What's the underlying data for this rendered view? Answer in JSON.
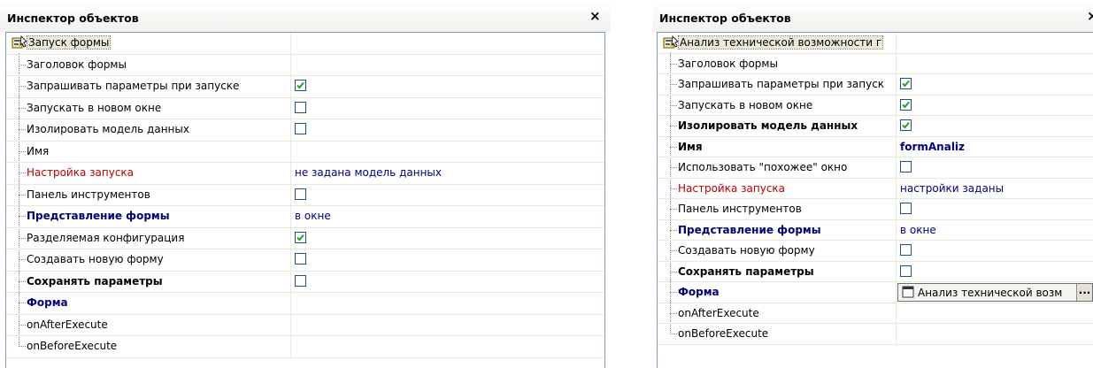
{
  "left": {
    "title": "Инспектор объектов",
    "close": "×",
    "root_label": "Запуск формы",
    "rows": [
      {
        "name": "Заголовок формы",
        "style": "normal",
        "type": "text",
        "value": ""
      },
      {
        "name": "Запрашивать параметры при запуске",
        "style": "normal",
        "type": "checkbox",
        "checked": true
      },
      {
        "name": "Запускать в новом окне",
        "style": "normal",
        "type": "checkbox",
        "checked": false
      },
      {
        "name": "Изолировать модель данных",
        "style": "normal",
        "type": "checkbox",
        "checked": false
      },
      {
        "name": "Имя",
        "style": "normal",
        "type": "text",
        "value": ""
      },
      {
        "name": "Настройка запуска",
        "style": "red",
        "type": "text",
        "value": "не задана модель данных"
      },
      {
        "name": "Панель инструментов",
        "style": "normal",
        "type": "checkbox",
        "checked": false
      },
      {
        "name": "Представление формы",
        "style": "navy",
        "type": "text",
        "value": "в окне"
      },
      {
        "name": "Разделяемая конфигурация",
        "style": "normal",
        "type": "checkbox",
        "checked": true
      },
      {
        "name": "Создавать новую форму",
        "style": "normal",
        "type": "checkbox",
        "checked": false
      },
      {
        "name": "Сохранять параметры",
        "style": "bold",
        "type": "checkbox",
        "checked": false
      },
      {
        "name": "Форма",
        "style": "navy",
        "type": "text",
        "value": ""
      },
      {
        "name": "onAfterExecute",
        "style": "normal",
        "type": "text",
        "value": ""
      },
      {
        "name": "onBeforeExecute",
        "style": "normal",
        "type": "text",
        "value": ""
      }
    ]
  },
  "right": {
    "title": "Инспектор объектов",
    "close": "×",
    "root_label": "Анализ технической возможности г",
    "rows": [
      {
        "name": "Заголовок формы",
        "style": "normal",
        "type": "text",
        "value": ""
      },
      {
        "name": "Запрашивать параметры при запуск",
        "style": "normal",
        "type": "checkbox",
        "checked": true
      },
      {
        "name": "Запускать в новом окне",
        "style": "normal",
        "type": "checkbox",
        "checked": true
      },
      {
        "name": "Изолировать модель данных",
        "style": "bold",
        "type": "checkbox",
        "checked": true
      },
      {
        "name": "Имя",
        "style": "bold",
        "type": "text",
        "value": "formAnaliz",
        "value_bold": true
      },
      {
        "name": "Использовать \"похожее\" окно",
        "style": "normal",
        "type": "checkbox",
        "checked": false
      },
      {
        "name": "Настройка запуска",
        "style": "red",
        "type": "text",
        "value": "настройки заданы"
      },
      {
        "name": "Панель инструментов",
        "style": "normal",
        "type": "checkbox",
        "checked": false
      },
      {
        "name": "Представление формы",
        "style": "navy",
        "type": "text",
        "value": "в окне"
      },
      {
        "name": "Создавать новую форму",
        "style": "normal",
        "type": "checkbox",
        "checked": false
      },
      {
        "name": "Сохранять параметры",
        "style": "bold",
        "type": "checkbox",
        "checked": false
      },
      {
        "name": "Форма",
        "style": "navy",
        "type": "form",
        "value": "Анализ технической возм",
        "button": "..."
      },
      {
        "name": "onAfterExecute",
        "style": "normal",
        "type": "text",
        "value": ""
      },
      {
        "name": "onBeforeExecute",
        "style": "normal",
        "type": "text",
        "value": ""
      }
    ]
  },
  "icons": {
    "root": "object-inspector-icon",
    "checkbox": "checkmark-icon",
    "form": "form-icon"
  }
}
